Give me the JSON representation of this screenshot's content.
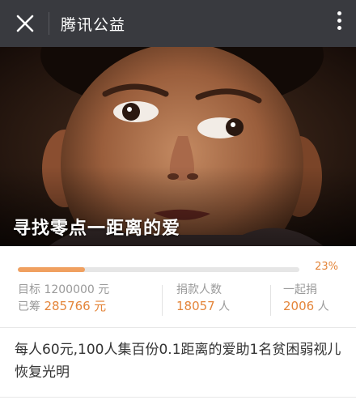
{
  "header": {
    "title": "腾讯公益",
    "close_icon": "close-icon",
    "more_icon": "more-vertical-icon",
    "bg_color": "#393a3f"
  },
  "hero": {
    "caption": "寻找零点一距离的爱"
  },
  "progress": {
    "percent_label": "23%",
    "fraction": 0.238,
    "fill_color": "#f0a060"
  },
  "stats": {
    "target_label": "目标",
    "target_value": "1200000",
    "target_unit": "元",
    "raised_label": "已筹",
    "raised_value": "285766",
    "raised_unit": "元",
    "donors_label": "捐款人数",
    "donors_value": "18057",
    "donors_unit": "人",
    "together_label": "一起捐",
    "together_value": "2006",
    "together_unit": "人"
  },
  "description": "每人60元,100人集百份0.1距离的爱助1名贫困弱视儿恢复光明",
  "accent_color": "#e4853a"
}
